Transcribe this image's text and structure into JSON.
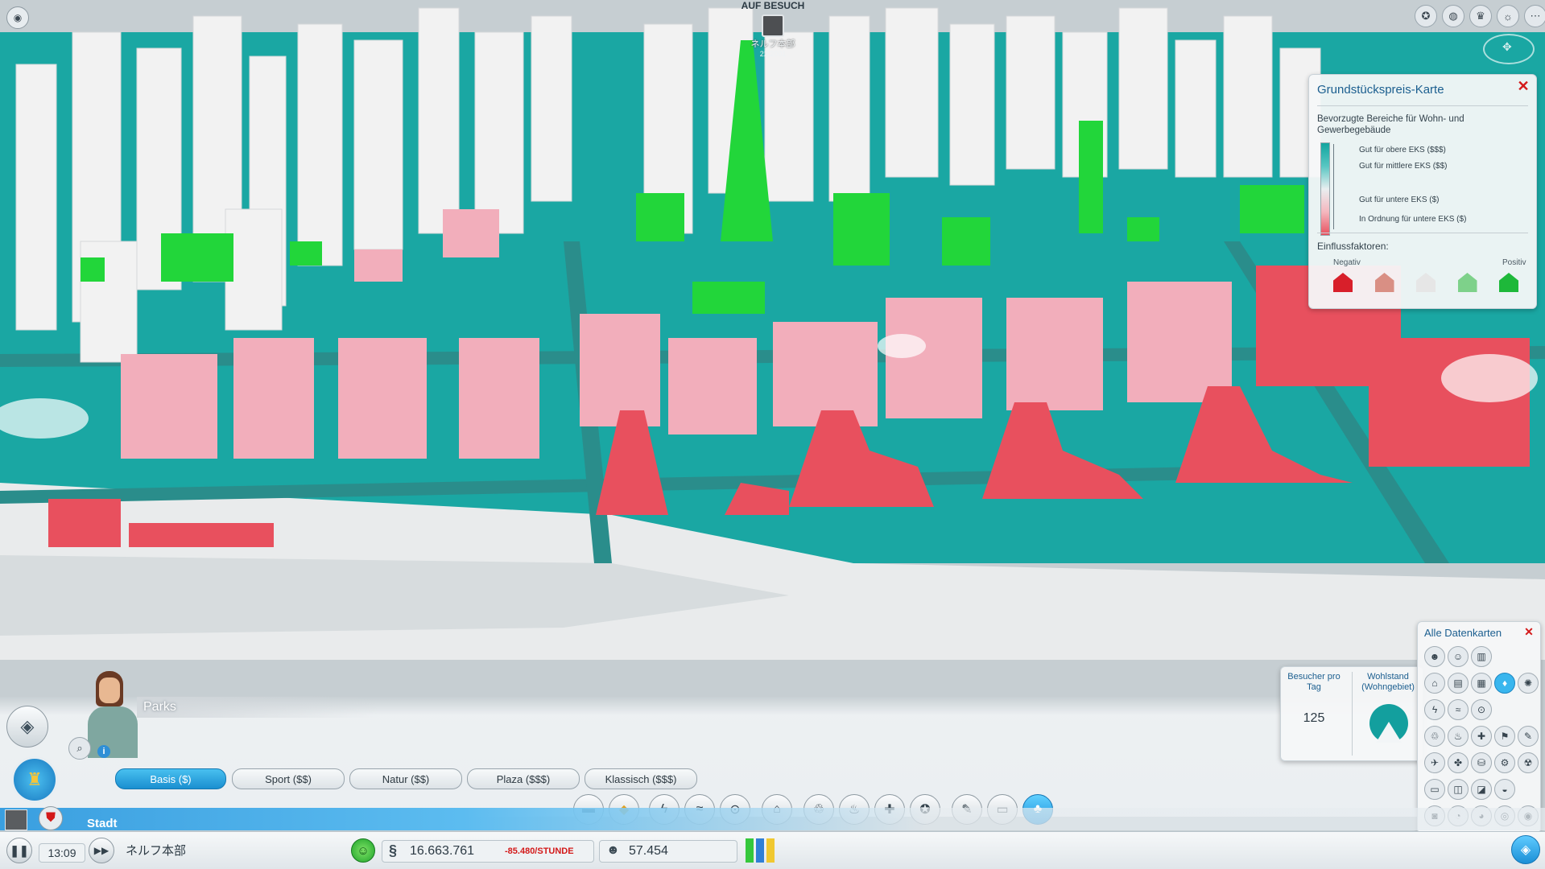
{
  "visiting": {
    "label": "AUF BESUCH",
    "city": "ネルフ本部",
    "sub": "22.2001"
  },
  "top_icons": [
    "badge-icon",
    "globe-icon",
    "trophy-icon",
    "weather-icon",
    "menu-icon"
  ],
  "land_value_panel": {
    "title": "Grundstückspreis-Karte",
    "description": "Bevorzugte Bereiche für Wohn- und Gewerbegebäude",
    "legend": [
      "Gut für obere EKS ($$$)",
      "Gut für mittlere EKS ($$)",
      "Gut für untere EKS ($)",
      "In Ordnung für untere EKS ($)"
    ],
    "factors_label": "Einflussfaktoren:",
    "negative_label": "Negativ",
    "positive_label": "Positiv",
    "factor_colors": [
      "#d81f2a",
      "#d98f84",
      "#e6e6e6",
      "#7ed18a",
      "#1eb83a"
    ]
  },
  "advisor": {
    "name": "Parks"
  },
  "park_tabs": [
    "Basis ($)",
    "Sport ($$)",
    "Natur ($$)",
    "Plaza ($$$)",
    "Klassisch ($$$)"
  ],
  "active_tab": 0,
  "stats": {
    "visitors_label": "Besucher pro Tag",
    "visitors_value": "125",
    "wealth_label": "Wohlstand (Wohngebiet)"
  },
  "data_maps": {
    "title": "Alle Datenkarten"
  },
  "status_bar": {
    "time": "13:09",
    "city_name": "ネルフ本部",
    "money": "16.663.761",
    "income": "-85.480/STUNDE",
    "population": "57.454",
    "region_label": "Stadt"
  },
  "colors": {
    "accent": "#1a8fd0",
    "teal_ground": "#1aa7a3",
    "industrial": "#e8505e",
    "parks": "#22d63a"
  }
}
